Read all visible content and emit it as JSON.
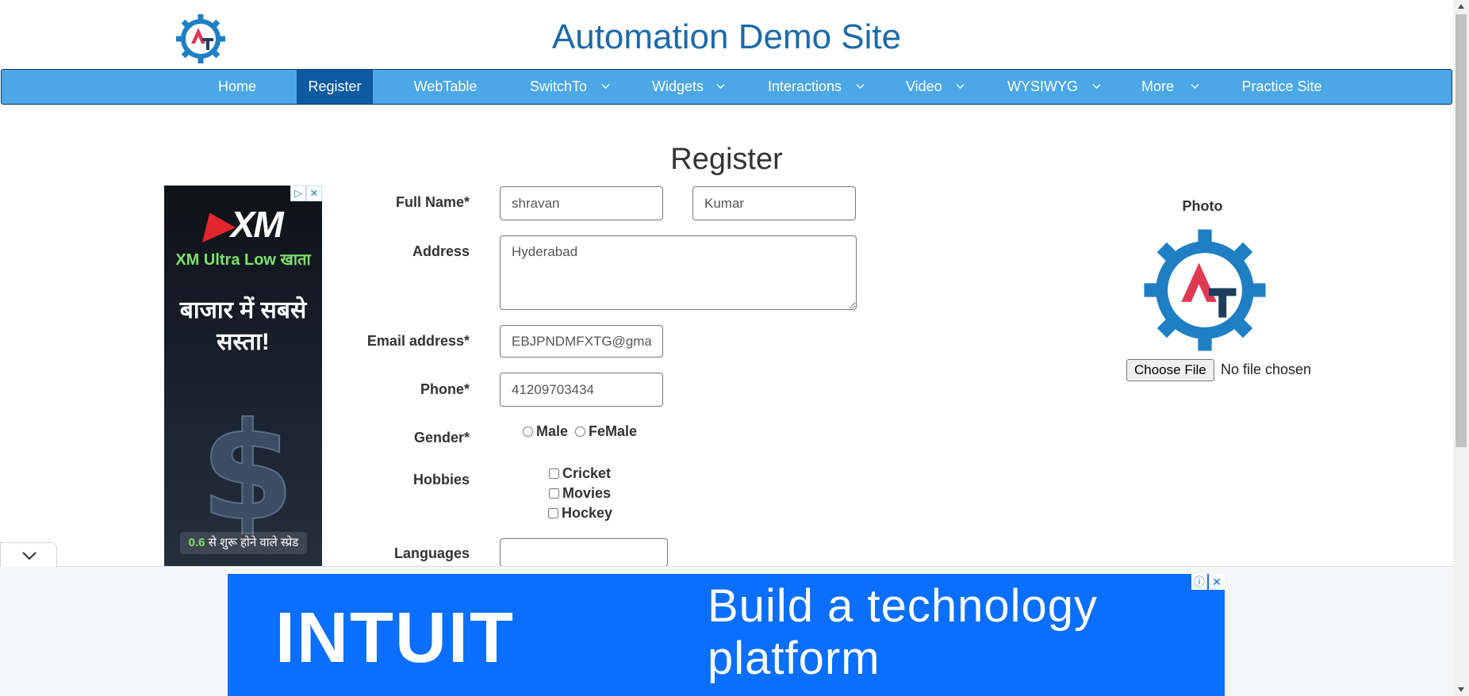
{
  "header": {
    "title": "Automation Demo Site",
    "logo_letters": "AT"
  },
  "nav": {
    "items": [
      {
        "label": "Home",
        "active": false,
        "dropdown": false
      },
      {
        "label": "Register",
        "active": true,
        "dropdown": false
      },
      {
        "label": "WebTable",
        "active": false,
        "dropdown": false
      },
      {
        "label": "SwitchTo",
        "active": false,
        "dropdown": true
      },
      {
        "label": "Widgets",
        "active": false,
        "dropdown": true
      },
      {
        "label": "Interactions",
        "active": false,
        "dropdown": true
      },
      {
        "label": "Video",
        "active": false,
        "dropdown": true
      },
      {
        "label": "WYSIWYG",
        "active": false,
        "dropdown": true
      },
      {
        "label": "More",
        "active": false,
        "dropdown": true
      },
      {
        "label": "Practice Site",
        "active": false,
        "dropdown": false
      }
    ],
    "colors": {
      "bar": "#4ba7e6",
      "active": "#0d5aa0"
    }
  },
  "form": {
    "title": "Register",
    "labels": {
      "full_name": "Full Name*",
      "address": "Address",
      "email": "Email address*",
      "phone": "Phone*",
      "gender": "Gender*",
      "hobbies": "Hobbies",
      "languages": "Languages"
    },
    "values": {
      "first_name": "shravan",
      "last_name": "Kumar",
      "address": "Hyderabad",
      "email": "EBJPNDMFXTG@gmail.com",
      "phone": "41209703434",
      "languages": ""
    },
    "gender_options": [
      "Male",
      "FeMale"
    ],
    "hobbies": [
      "Cricket",
      "Movies",
      "Hockey"
    ]
  },
  "photo": {
    "label": "Photo",
    "choose_button": "Choose File",
    "status": "No file chosen"
  },
  "side_ad": {
    "brand": "XM",
    "subline": "XM Ultra Low खाता",
    "headline": "बाजार में सबसे सस्ता!",
    "footer_value": "0.6",
    "footer_text": "से शुरू होने वाले स्प्रेड"
  },
  "bottom_ad": {
    "brand": "INTUIT",
    "headline": "Build a technology platform",
    "color": "#0a6ffe"
  },
  "icons": [
    "at-gear-logo",
    "chevron-down-icon",
    "ad-info-icon",
    "ad-close-icon",
    "collapse-chevron-icon"
  ]
}
